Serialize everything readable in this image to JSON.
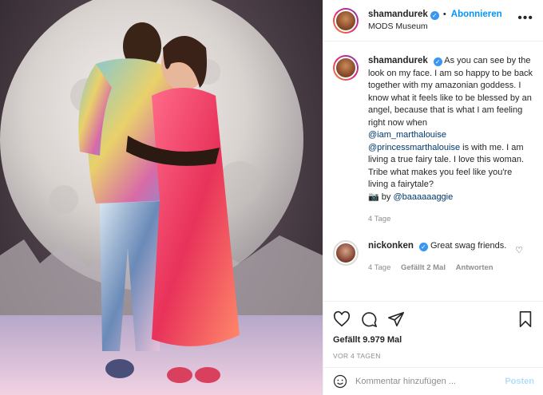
{
  "header": {
    "username": "shamandurek",
    "verified_icon": "verified-badge-icon",
    "separator": "•",
    "follow_label": "Abonnieren",
    "location": "MODS Museum",
    "more_icon": "more-options-icon"
  },
  "caption": {
    "username": "shamandurek",
    "text_1": "As you can see by the look on my face. I am so happy to be back together with my amazonian goddess. I know what it feels like to be blessed by an angel, because that is what I am feeling right now when",
    "mention_1": "@iam_marthalouise",
    "mention_2": "@princessmarthalouise",
    "text_2": "is with me. I am living a true fairy tale. I love this woman.",
    "text_3": "Tribe what makes you feel like you're living a fairytale?",
    "camera_emoji": "📷",
    "by_label": "by",
    "mention_3": "@baaaaaaggie",
    "time": "4 Tage"
  },
  "comment": {
    "username": "nickonken",
    "text": "Great swag friends.",
    "time": "4 Tage",
    "likes": "Gefällt 2 Mal",
    "reply_label": "Antworten"
  },
  "actions": {
    "likes": "Gefällt 9.979 Mal",
    "date": "VOR 4 TAGEN"
  },
  "add_comment": {
    "placeholder": "Kommentar hinzufügen ...",
    "post_label": "Posten"
  },
  "colors": {
    "accent": "#0095f6",
    "verified": "#3897f0",
    "mention": "#00376b",
    "muted": "#8e8e8e"
  }
}
